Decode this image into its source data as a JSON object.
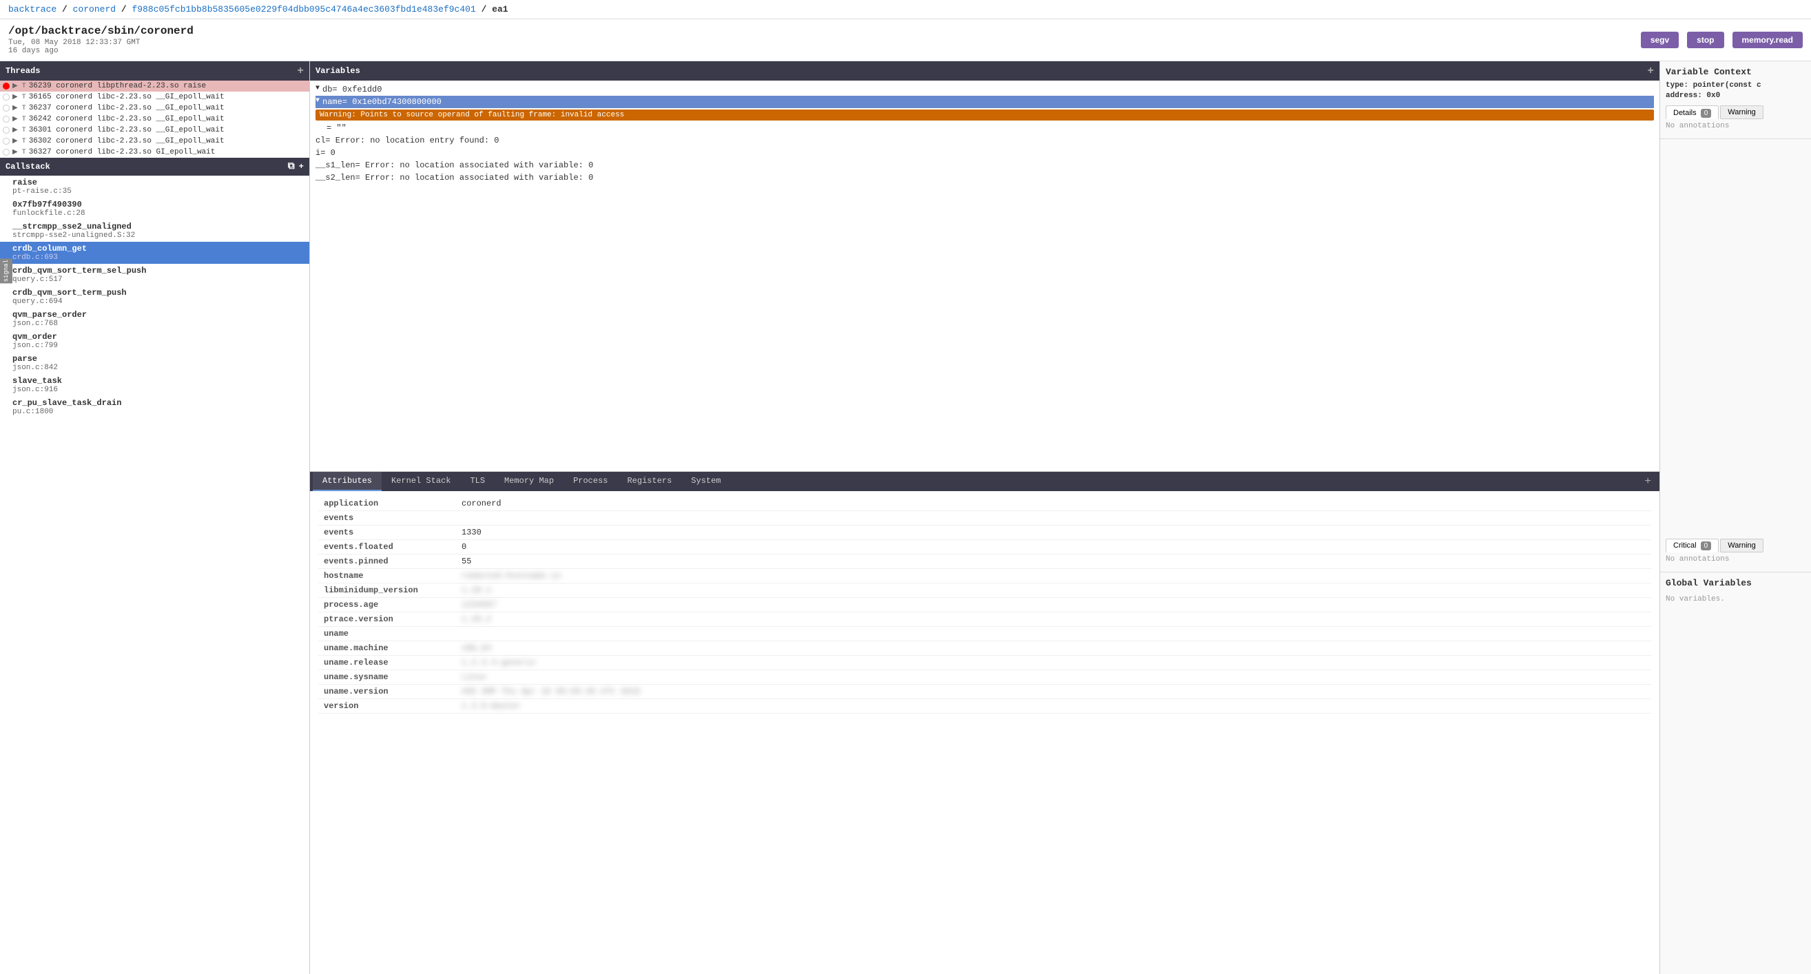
{
  "breadcrumb": {
    "parts": [
      "backtrace",
      "coronerd",
      "f988c05fcb1bb8b5835605e0229f04dbb095c4746a4ec3603fbd1e483ef9c401",
      "ea1"
    ],
    "separator": " / "
  },
  "header": {
    "title": "/opt/backtrace/sbin/coronerd",
    "date": "Tue, 08 May 2018 12:33:37 GMT",
    "age": "16 days ago",
    "buttons": {
      "segv": "segv",
      "stop": "stop",
      "memory_read": "memory.read"
    }
  },
  "threads": {
    "panel_label": "Threads",
    "items": [
      {
        "id": "36239",
        "name": "coronerd",
        "lib": "libpthread-2.23.so",
        "fn": "raise",
        "indicator": "red",
        "active": true
      },
      {
        "id": "36165",
        "name": "coronerd",
        "lib": "libc-2.23.so",
        "fn": "__GI_epoll_wait",
        "indicator": "empty",
        "active": false
      },
      {
        "id": "36237",
        "name": "coronerd",
        "lib": "libc-2.23.so",
        "fn": "__GI_epoll_wait",
        "indicator": "empty",
        "active": false
      },
      {
        "id": "36242",
        "name": "coronerd",
        "lib": "libc-2.23.so",
        "fn": "__GI_epoll_wait",
        "indicator": "empty",
        "active": false
      },
      {
        "id": "36301",
        "name": "coronerd",
        "lib": "libc-2.23.so",
        "fn": "__GI_epoll_wait",
        "indicator": "empty",
        "active": false
      },
      {
        "id": "36302",
        "name": "coronerd",
        "lib": "libc-2.23.so",
        "fn": "__GI_epoll_wait",
        "indicator": "empty",
        "active": false
      },
      {
        "id": "36327",
        "name": "coronerd",
        "lib": "libc-2.23.so",
        "fn": "GI_epoll_wait",
        "indicator": "empty",
        "active": false
      }
    ]
  },
  "callstack": {
    "panel_label": "Callstack",
    "items": [
      {
        "fn": "raise",
        "loc": "pt-raise.c:35",
        "active": false
      },
      {
        "fn": "0x7fb97f490390",
        "loc": "funlockfile.c:28",
        "active": false
      },
      {
        "fn": "__strcmpp_sse2_unaligned",
        "loc": "strcmpp-sse2-unaligned.S:32",
        "active": false
      },
      {
        "fn": "crdb_column_get",
        "loc": "crdb.c:693",
        "active": true
      },
      {
        "fn": "crdb_qvm_sort_term_sel_push",
        "loc": "query.c:517",
        "active": false
      },
      {
        "fn": "crdb_qvm_sort_term_push",
        "loc": "query.c:694",
        "active": false
      },
      {
        "fn": "qvm_parse_order",
        "loc": "json.c:768",
        "active": false
      },
      {
        "fn": "qvm_order",
        "loc": "json.c:799",
        "active": false
      },
      {
        "fn": "parse",
        "loc": "json.c:842",
        "active": false
      },
      {
        "fn": "slave_task",
        "loc": "json.c:916",
        "active": false
      },
      {
        "fn": "cr_pu_slave_task_drain",
        "loc": "pu.c:1800",
        "active": false
      }
    ]
  },
  "variables": {
    "panel_label": "Variables",
    "items": [
      {
        "name": "db",
        "value": "= 0xfe1dd0",
        "indent": 0,
        "expand": true,
        "highlighted": false
      },
      {
        "name": "name",
        "value": "= 0x1e0bd74300800000",
        "indent": 0,
        "expand": true,
        "highlighted": true,
        "warning": "Warning: Points to source operand of faulting frame: invalid access"
      },
      {
        "name": "",
        "value": "= \"\"",
        "indent": 1,
        "highlighted": false
      },
      {
        "name": "cl",
        "value": "= Error: no location entry found: 0",
        "indent": 0,
        "highlighted": false
      },
      {
        "name": "i",
        "value": "= 0",
        "indent": 0,
        "highlighted": false
      },
      {
        "name": "__s1_len",
        "value": "= Error: no location associated with variable: 0",
        "indent": 0,
        "highlighted": false
      },
      {
        "name": "__s2_len",
        "value": "= Error: no location associated with variable: 0",
        "indent": 0,
        "highlighted": false
      }
    ]
  },
  "bottom_tabs": {
    "tabs": [
      "Attributes",
      "Kernel Stack",
      "TLS",
      "Memory Map",
      "Process",
      "Registers",
      "System"
    ],
    "active": "Attributes"
  },
  "attributes": {
    "rows": [
      {
        "key": "application",
        "value": "coronerd",
        "blurred": false
      },
      {
        "key": "events",
        "value": "",
        "blurred": false,
        "is_group": true
      },
      {
        "key": "events",
        "value": "1330",
        "blurred": false
      },
      {
        "key": "events.floated",
        "value": "0",
        "blurred": false
      },
      {
        "key": "events.pinned",
        "value": "55",
        "blurred": false
      },
      {
        "key": "hostname",
        "value": "redacted.hostname.io",
        "blurred": true
      },
      {
        "key": "libminidump_version",
        "value": "1.20.1",
        "blurred": true
      },
      {
        "key": "process.age",
        "value": "1234567",
        "blurred": true
      },
      {
        "key": "ptrace.version",
        "value": "1.20.2",
        "blurred": true
      },
      {
        "key": "uname",
        "value": "",
        "blurred": false,
        "is_group": true
      },
      {
        "key": "uname.machine",
        "value": "x86_64",
        "blurred": true
      },
      {
        "key": "uname.release",
        "value": "1.2.3.4-generic",
        "blurred": true
      },
      {
        "key": "uname.sysname",
        "value": "Linux",
        "blurred": true
      },
      {
        "key": "uname.version",
        "value": "#65 SMP Thu Apr 18 09:50:30 UTC 2018",
        "blurred": true
      },
      {
        "key": "version",
        "value": "1.3.0-master",
        "blurred": true
      }
    ]
  },
  "variable_context": {
    "title": "Variable Context",
    "type_label": "type:",
    "type_value": "pointer(const c",
    "address_label": "address:",
    "address_value": "0x0",
    "tabs": [
      "Details 0",
      "Warning"
    ],
    "no_annotations": "No annotations",
    "critical_tabs": [
      "Critical 0",
      "Warning"
    ],
    "no_annotations_2": "No annotations"
  },
  "global_variables": {
    "title": "Global Variables",
    "text": "No variables."
  }
}
